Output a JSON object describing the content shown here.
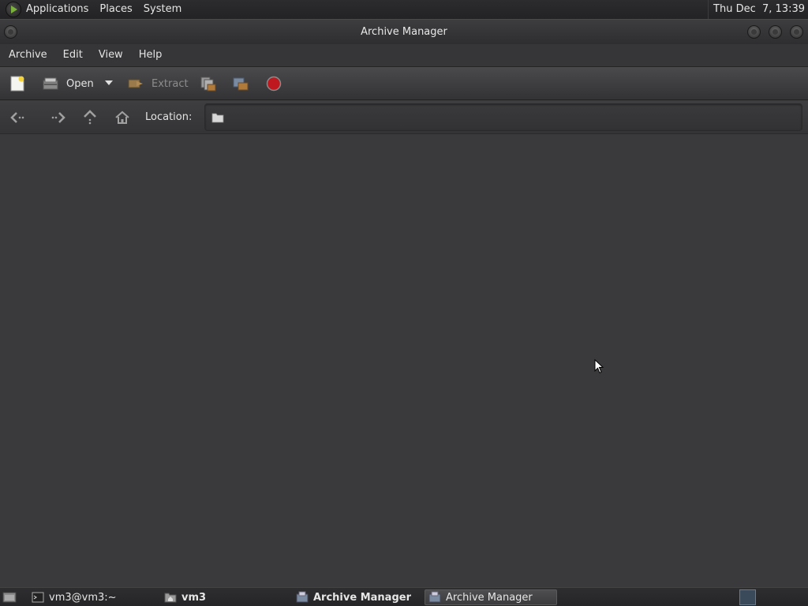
{
  "top_panel": {
    "menus": [
      "Applications",
      "Places",
      "System"
    ],
    "clock": "Thu Dec  7, 13:39"
  },
  "window": {
    "title": "Archive Manager"
  },
  "menubar": {
    "items": [
      "Archive",
      "Edit",
      "View",
      "Help"
    ]
  },
  "toolbar": {
    "open_label": "Open",
    "extract_label": "Extract"
  },
  "location": {
    "label": "Location:",
    "value": ""
  },
  "taskbar": {
    "tasks": [
      {
        "label": "vm3@vm3:~",
        "icon": "terminal-icon"
      },
      {
        "label": "vm3",
        "icon": "home-folder-icon"
      },
      {
        "label": "Archive Manager",
        "icon": "archive-manager-icon"
      },
      {
        "label": "Archive Manager",
        "icon": "archive-manager-icon"
      }
    ]
  },
  "colors": {
    "background": "#3a3a3c",
    "panel": "#2c2c2e",
    "stop_red": "#c0181f"
  }
}
